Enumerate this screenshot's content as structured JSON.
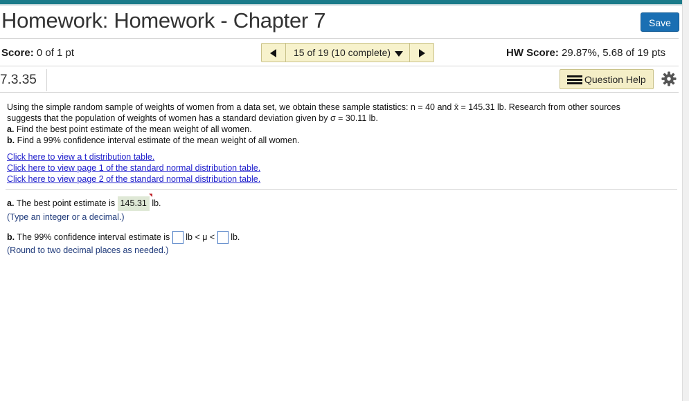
{
  "header": {
    "title": "Homework: Homework - Chapter 7",
    "save_label": "Save"
  },
  "score_bar": {
    "score_label": "Score:",
    "score_value": "0 of 1 pt",
    "nav_label": "15 of 19 (10 complete)",
    "hw_score_label": "HW Score:",
    "hw_score_value": "29.87%, 5.68 of 19 pts"
  },
  "question": {
    "number": "7.3.35",
    "help_label": "Question Help",
    "prompt_line1": "Using the simple random sample of weights of women from a data set, we obtain these sample statistics: n = 40 and x̄ = 145.31 lb. Research from other sources",
    "prompt_line2": "suggests that the population of weights of women has a standard deviation given by σ = 30.11 lb.",
    "part_a_label": "a.",
    "part_a_text": "Find the best point estimate of the mean weight of all women.",
    "part_b_label": "b.",
    "part_b_text": "Find a 99% confidence interval estimate of the mean weight of all women."
  },
  "links": [
    "Click here to view a t distribution table.",
    "Click here to view page 1 of the standard normal distribution table.",
    "Click here to view page 2 of the standard normal distribution table."
  ],
  "answers": {
    "a_label": "a.",
    "a_text": "The best point estimate is",
    "a_value": "145.31",
    "a_unit": "lb.",
    "a_hint": "(Type an integer or a decimal.)",
    "b_label": "b.",
    "b_text": "The 99% confidence interval estimate is",
    "b_mid": "lb < μ <",
    "b_unit": "lb.",
    "b_hint": "(Round to two decimal places as needed.)"
  },
  "colors": {
    "accent": "#1b7b8a",
    "save_button": "#1a6fb3",
    "nav_background": "#f7f2cc",
    "link": "#1d1dcc",
    "answer_fill": "#dfe8d6"
  }
}
